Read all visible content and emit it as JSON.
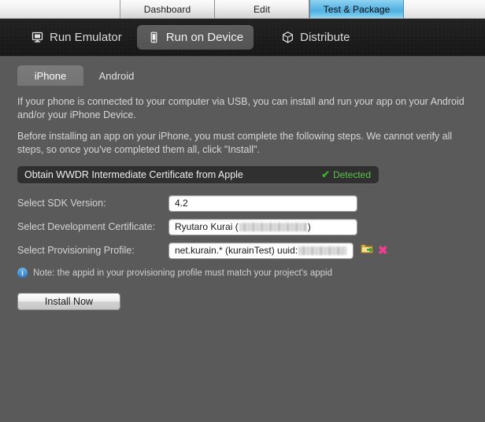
{
  "window_tabs": {
    "items": [
      {
        "label": "Dashboard",
        "active": false
      },
      {
        "label": "Edit",
        "active": false
      },
      {
        "label": "Test & Package",
        "active": true
      }
    ]
  },
  "main_tabs": {
    "items": [
      {
        "label": "Run Emulator",
        "icon": "emulator-icon",
        "active": false
      },
      {
        "label": "Run on Device",
        "icon": "phone-icon",
        "active": true
      },
      {
        "label": "Distribute",
        "icon": "cube-icon",
        "active": false
      }
    ]
  },
  "sub_tabs": {
    "items": [
      {
        "label": "iPhone",
        "active": true
      },
      {
        "label": "Android",
        "active": false
      }
    ]
  },
  "description": {
    "paragraph1": "If your phone is connected to your computer via USB, you can install and run your app on your Android and/or your iPhone Device.",
    "paragraph2": "Before installing an app on your iPhone, you must complete the following steps. We cannot verify all steps, so once you've completed them all, click \"Install\"."
  },
  "wwdr": {
    "label": "Obtain WWDR Intermediate Certificate from Apple",
    "status": "Detected",
    "check_glyph": "✔",
    "status_color": "#5cc24a"
  },
  "form": {
    "rows": [
      {
        "label": "Select SDK Version:",
        "value": "4.2"
      },
      {
        "label": "Select Development Certificate:",
        "value_prefix": "Ryutaro Kurai (",
        "value_suffix": ")",
        "redacted": true
      },
      {
        "label": "Select Provisioning Profile:",
        "value_prefix": "net.kurain.* (kurainTest) uuid:",
        "value_suffix": "",
        "redacted": true
      }
    ]
  },
  "row_icons": {
    "folder_label": "folder-open-icon",
    "delete_glyph": "✖"
  },
  "note": {
    "info_glyph": "i",
    "text": "Note: the appid in your provisioning profile must match your project's appid"
  },
  "install": {
    "label": "Install Now"
  },
  "colors": {
    "panel_bg": "#5a5a5b",
    "header_bg": "#1c1c1d",
    "active_tab_blue": "#68bde8",
    "detected_green": "#5cc24a",
    "delete_pink": "#ec3f8f"
  }
}
